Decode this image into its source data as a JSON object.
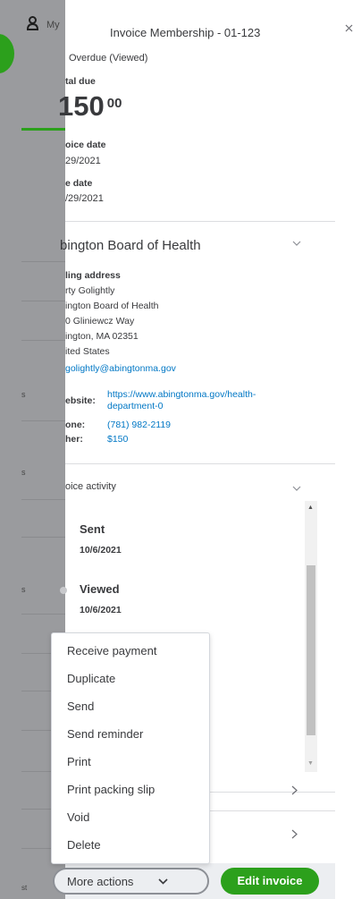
{
  "background_app": {
    "user_label": "My",
    "side_snippets": [
      "s",
      "s",
      "s",
      "st"
    ]
  },
  "panel": {
    "title": "Invoice Membership - 01-123",
    "status": "Overdue (Viewed)",
    "total_due_label": "tal due",
    "total_due_dollars": "150",
    "total_due_cents": "00",
    "invoice_date_label": "oice date",
    "invoice_date": "29/2021",
    "due_date_label": "e date",
    "due_date": "/29/2021"
  },
  "customer": {
    "name": "bington Board of Health",
    "billing_label": "ling address",
    "address_lines": [
      "rty Golightly",
      "ington Board of Health",
      "0 Gliniewcz Way",
      "ington, MA  02351",
      "ited States"
    ],
    "email": "golightly@abingtonma.gov",
    "website_label": "ebsite:",
    "website_line1": "https://www.abingtonma.gov/health-",
    "website_line2": "department-0",
    "phone_label": "one:",
    "phone": "(781) 982-2119",
    "other_label": "her:",
    "other": "$150"
  },
  "activity": {
    "header": "oice activity",
    "items": [
      {
        "title": "Sent",
        "date": "10/6/2021"
      },
      {
        "title": "Viewed",
        "date": "10/6/2021"
      }
    ]
  },
  "menu": {
    "items": [
      "Receive payment",
      "Duplicate",
      "Send",
      "Send reminder",
      "Print",
      "Print packing slip",
      "Void",
      "Delete"
    ]
  },
  "footer": {
    "more_actions": "More actions",
    "edit_invoice": "Edit invoice"
  },
  "icons": {
    "close": "close-icon",
    "chevron_down": "chevron-down-icon",
    "chevron_right": "chevron-right-icon",
    "user": "user-icon"
  },
  "colors": {
    "accent_green": "#2ca01c",
    "link_blue": "#0077c5",
    "overlay_gray": "#9a9b9e"
  }
}
